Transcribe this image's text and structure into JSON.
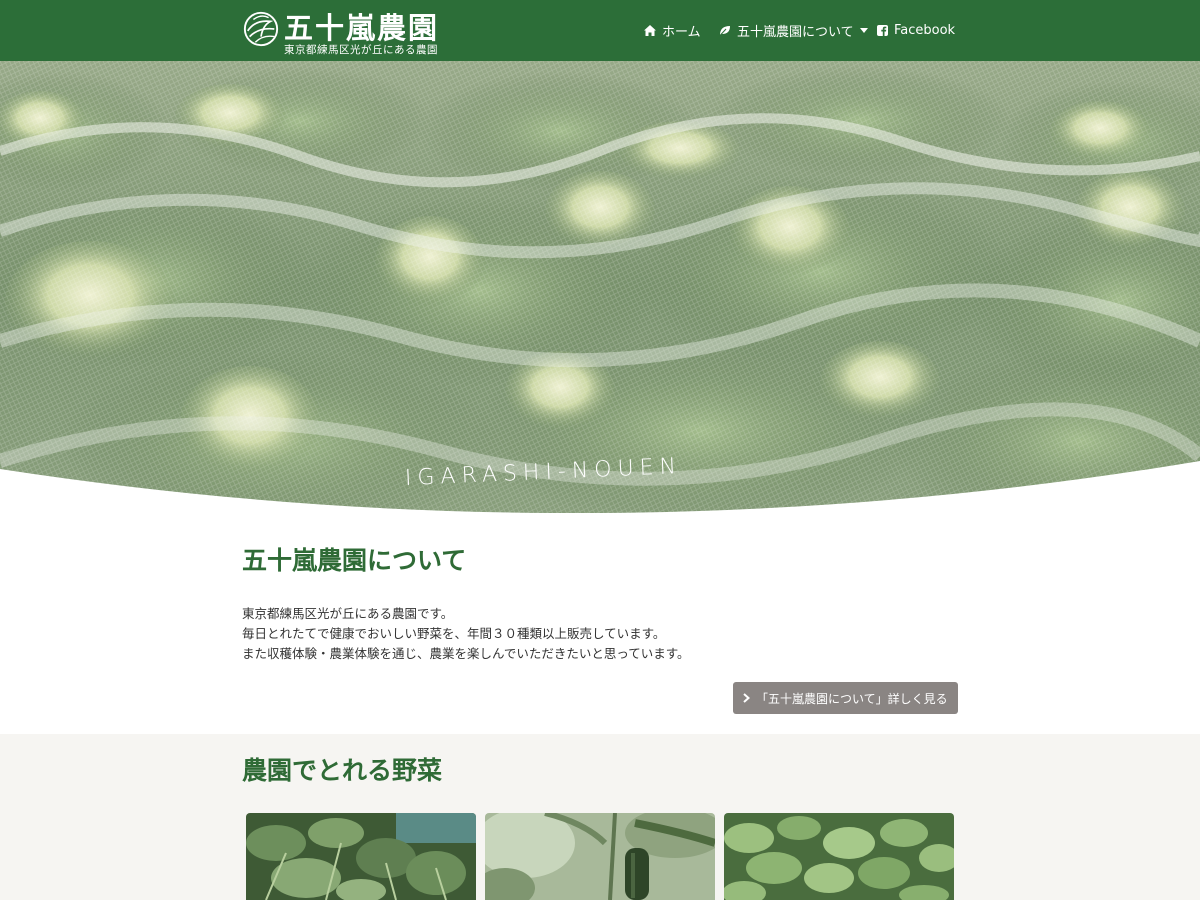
{
  "brand": {
    "title": "五十嵐農園",
    "subtitle": "東京都練馬区光が丘にある農園"
  },
  "nav": {
    "home_label": "ホーム",
    "about_label": "五十嵐農園について",
    "facebook_label": "Facebook"
  },
  "hero": {
    "caption": "IGARASHI-NOUEN"
  },
  "about": {
    "title": "五十嵐農園について",
    "lines": [
      "東京都練馬区光が丘にある農園です。",
      "毎日とれたてで健康でおいしい野菜を、年間３０種類以上販売しています。",
      "また収穫体験・農業体験を通じ、農業を楽しんでいただきたいと思っています。"
    ],
    "more_button": "「五十嵐農園について」詳しく見る"
  },
  "vegetables": {
    "title": "農園でとれる野菜"
  },
  "colors": {
    "nav_bg": "#2c6e38",
    "heading_green": "#2f6b36",
    "button_gray": "#8a8583",
    "section_bg": "#f6f5f2"
  }
}
